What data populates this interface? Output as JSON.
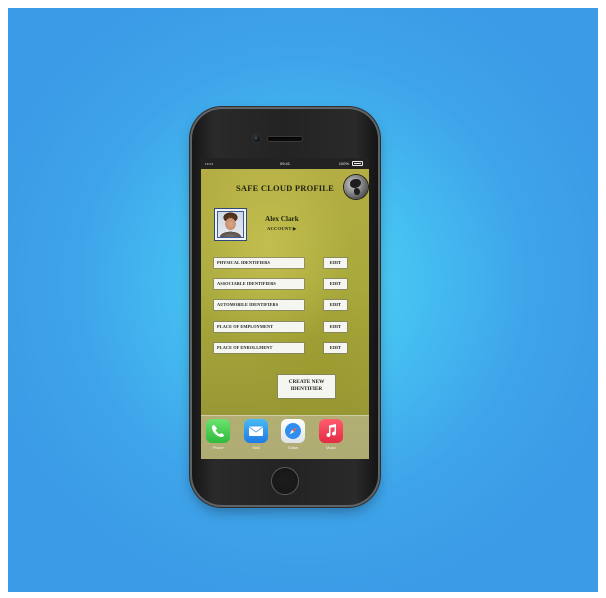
{
  "status_bar": {
    "signal": "•••••",
    "time": "09:41",
    "battery": "100%"
  },
  "header": {
    "title": "SAFE CLOUD PROFILE",
    "logo_icon": "globe-icon"
  },
  "profile": {
    "name": "Alex Clark",
    "account_label": "ACCOUNT ▶"
  },
  "identifiers": [
    {
      "label": "PHYSICAL IDENTIFIERS",
      "action": "EDIT"
    },
    {
      "label": "ASSOCIABLE IDENTIFIERS",
      "action": "EDIT"
    },
    {
      "label": "AUTOMOBILE IDENTIFIERS",
      "action": "EDIT"
    },
    {
      "label": "PLACE OF EMPLOYMENT",
      "action": "EDIT"
    },
    {
      "label": "PLACE OF ENROLLMENT",
      "action": "EDIT"
    }
  ],
  "create_button": "CREATE NEW\nIDENTIFIER",
  "dock": [
    {
      "label": "Phone",
      "icon": "phone-icon"
    },
    {
      "label": "Mail",
      "icon": "mail-icon"
    },
    {
      "label": "Safari",
      "icon": "compass-icon"
    },
    {
      "label": "Music",
      "icon": "music-note-icon"
    }
  ],
  "colors": {
    "background": "#45bff1",
    "screen": "#a9a93c",
    "phone_body": "#232323"
  }
}
